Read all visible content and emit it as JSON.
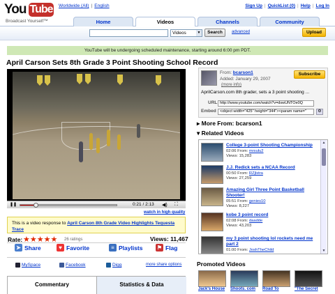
{
  "header": {
    "logo_you": "You",
    "logo_tube": "Tube",
    "tagline": "Broadcast Yourself™",
    "worldwide": "Worldwide (All)",
    "english": "English",
    "sign_up": "Sign Up",
    "quicklist": "QuickList (0)",
    "help": "Help",
    "log_in": "Log In",
    "tabs": [
      "Home",
      "Videos",
      "Channels",
      "Community"
    ],
    "active_tab": "Videos",
    "search_value": "",
    "search_type": "Videos",
    "search_button": "Search",
    "advanced": "advanced",
    "upload": "Upload"
  },
  "notice": "YouTube will be undergoing scheduled maintenance, starting around 6:00 pm PDT.",
  "video": {
    "title": "April Carson Sets 8th Grade 3 Point Shooting School Record",
    "time": "0:21 / 2:13",
    "progress": 0.16,
    "watch_hq": "watch in high quality",
    "response_prefix": "This is a video response to",
    "response_link": "April Carson 8th Grade Video Highlights Tequesta Trace",
    "rate_label": "Rate:",
    "stars": "★★★★★",
    "rating_value": 4.5,
    "ratings_count": "26 ratings",
    "views": "Views: 11,467",
    "actions": [
      "Share",
      "Favorite",
      "Playlists",
      "Flag"
    ],
    "social": [
      "MySpace",
      "Facebook",
      "Digg"
    ],
    "more_share": "more share options",
    "bottom_tabs": [
      "Commentary",
      "Statistics & Data"
    ]
  },
  "uploader": {
    "from_label": "From:",
    "from_user": "bcarson1",
    "added": "Added: January 29, 2007",
    "more_info": "(more info)",
    "subscribe": "Subscribe",
    "description": "AprilCarson.com 8th grader, sets a 3 point shooting ...",
    "url_label": "URL",
    "url_value": "http://www.youtube.com/watch?v=dswUNTOe0Q",
    "embed_label": "Embed",
    "embed_value": "<object width=\"425\" height=\"344\"><param name=\""
  },
  "more_from": "More From: bcarson1",
  "related_heading": "Related Videos",
  "related": [
    {
      "title": "College 3-point Shooting Championship",
      "time": "02:06",
      "from": "mrsulu2",
      "views": "Views: 15,283"
    },
    {
      "title": "J.J. Redick sets a NCAA Record",
      "time": "00:50",
      "from": "RZjlstra",
      "views": "Views: 27,259"
    },
    {
      "title": "Amazing Girl Three Point Basketball Shooter!",
      "time": "05:51",
      "from": "genies10",
      "views": "Views: 8,227"
    },
    {
      "title": "kobe 3 point record",
      "time": "02:08",
      "from": "daadde",
      "views": "Views: 43,203"
    },
    {
      "title": "my 3 point shooting lol rockets need me part 2",
      "time": "01:00",
      "from": "JoshTheChild",
      "views": ""
    }
  ],
  "from_label": "From:",
  "promoted_heading": "Promoted Videos",
  "promoted": [
    "Jack's House",
    "Shoots. com",
    "Road To",
    "\"The Secret"
  ]
}
